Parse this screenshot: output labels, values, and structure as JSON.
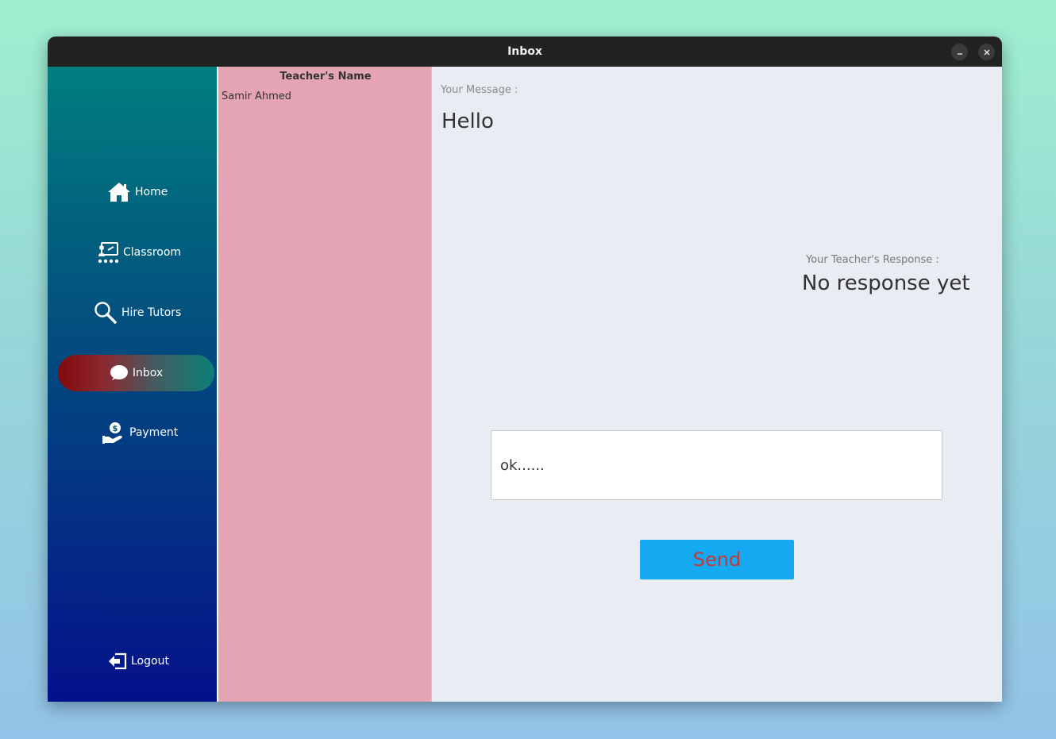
{
  "window": {
    "title": "Inbox"
  },
  "sidebar": {
    "items": [
      {
        "label": "Home",
        "icon": "home-icon"
      },
      {
        "label": "Classroom",
        "icon": "classroom-icon"
      },
      {
        "label": "Hire Tutors",
        "icon": "search-icon"
      },
      {
        "label": "Inbox",
        "icon": "chat-bubble-icon",
        "active": true
      },
      {
        "label": "Payment",
        "icon": "payment-hand-icon"
      }
    ],
    "logout_label": "Logout"
  },
  "teachers": {
    "header": "Teacher's Name",
    "rows": [
      "Samir Ahmed"
    ]
  },
  "conversation": {
    "message_label": "Your Message :",
    "message": "Hello",
    "response_label": "Your Teacher's Response :",
    "response": "No response yet"
  },
  "reply": {
    "value": "ok......"
  },
  "send_label": "Send",
  "colors": {
    "active_gradient_start": "#820a0a",
    "active_gradient_end": "#0c7f78",
    "send_button": "#15a9f2",
    "send_text": "#c23a3a",
    "teacher_panel": "#e5a4b4"
  }
}
